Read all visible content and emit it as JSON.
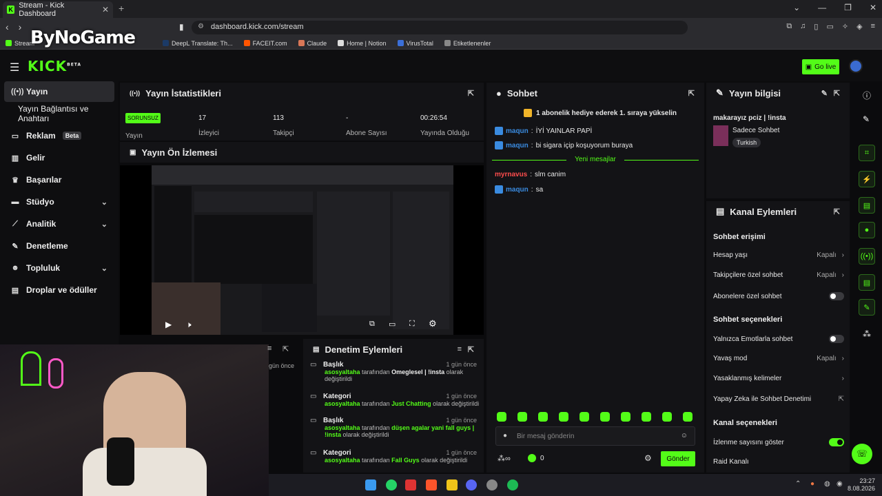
{
  "browser": {
    "tab_title": "Stream - Kick Dashboard",
    "url": "dashboard.kick.com/stream",
    "bookmarks": [
      "Stream",
      "DeepL Translate: Th...",
      "FACEIT.com",
      "Claude",
      "Home | Notion",
      "VirusTotal",
      "Etiketlenenler"
    ]
  },
  "overlay_logo": "ByNoGame",
  "header": {
    "logo": "KICK",
    "logo_badge": "BETA",
    "go_live": "Go live"
  },
  "sidebar": {
    "items": [
      {
        "label": "Yayın",
        "icon": "broadcast-icon"
      },
      {
        "label": "Yayın Bağlantısı ve Anahtarı",
        "icon": ""
      },
      {
        "label": "Reklam",
        "icon": "ad-icon",
        "badge": "Beta"
      },
      {
        "label": "Gelir",
        "icon": "revenue-icon"
      },
      {
        "label": "Başarılar",
        "icon": "trophy-icon"
      },
      {
        "label": "Stüdyo",
        "icon": "studio-icon"
      },
      {
        "label": "Analitik",
        "icon": "analytics-icon"
      },
      {
        "label": "Denetleme",
        "icon": "wrench-icon"
      },
      {
        "label": "Topluluk",
        "icon": "community-icon"
      },
      {
        "label": "Droplar ve ödüller",
        "icon": "drops-icon"
      }
    ]
  },
  "stats": {
    "title": "Yayın İstatistikleri",
    "items": [
      {
        "value": "SORUNSUZ",
        "label": "Yayın"
      },
      {
        "value": "17",
        "label": "İzleyici"
      },
      {
        "value": "113",
        "label": "Takipçi"
      },
      {
        "value": "-",
        "label": "Abone Sayısı"
      },
      {
        "value": "00:26:54",
        "label": "Yayında Olduğu"
      }
    ]
  },
  "preview": {
    "title": "Yayın Ön İzlemesi"
  },
  "chat": {
    "title": "Sohbet",
    "pinned": "1 abonelik hediye ederek 1. sıraya yükselin",
    "messages_before": [
      {
        "user": "maqun",
        "text": "İYİ YAINLAR PAPİ",
        "color": "#3a8be0"
      },
      {
        "user": "maqun",
        "text": "bi sigara içip koşuyorum buraya",
        "color": "#3a8be0"
      }
    ],
    "new_messages_label": "Yeni mesajlar",
    "messages_after": [
      {
        "user": "myrnavus",
        "text": "slm canim",
        "color": "#ff4d4d"
      },
      {
        "user": "maqun",
        "text": "sa",
        "color": "#3a8be0"
      }
    ],
    "input_placeholder": "Bir mesaj gönderin",
    "points": "0",
    "send": "Gönder"
  },
  "stream_info": {
    "title": "Yayın bilgisi",
    "stream_title": "makarayız pciz | !insta",
    "category": "Sadece Sohbet",
    "tag": "Turkish"
  },
  "channel_actions": {
    "title": "Kanal Eylemleri",
    "chat_access": "Sohbet erişimi",
    "account_age": {
      "label": "Hesap yaşı",
      "value": "Kapalı"
    },
    "followers_only": {
      "label": "Takipçilere özel sohbet",
      "value": "Kapalı"
    },
    "subscribers_only": {
      "label": "Abonelere özel sohbet"
    },
    "chat_options": "Sohbet seçenekleri",
    "emotes_only": {
      "label": "Yalnızca Emotlarla sohbet"
    },
    "slow_mode": {
      "label": "Yavaş mod",
      "value": "Kapalı"
    },
    "banned_words": {
      "label": "Yasaklanmış kelimeler"
    },
    "ai_moderation": {
      "label": "Yapay Zeka ile Sohbet Denetimi"
    },
    "channel_options": "Kanal seçenekleri",
    "show_viewers": {
      "label": "İzlenme sayısını göster"
    },
    "raid": {
      "label": "Raid Kanalı"
    }
  },
  "moderation": {
    "title": "Denetim Eylemleri",
    "left_when": "gün önce",
    "entries": [
      {
        "type": "Başlık",
        "when": "1 gün önce",
        "user": "asosyaltaha",
        "mid": "tarafından",
        "value": "Omeglesel | !insta",
        "tail": "olarak değiştirildi"
      },
      {
        "type": "Kategori",
        "when": "1 gün önce",
        "user": "asosyaltaha",
        "mid": "tarafından",
        "value": "Just Chatting",
        "tail": "olarak değiştirildi"
      },
      {
        "type": "Başlık",
        "when": "1 gün önce",
        "user": "asosyaltaha",
        "mid": "tarafından",
        "value": "düşen agalar yani fall guys | !insta",
        "tail": "olarak değiştirildi"
      },
      {
        "type": "Kategori",
        "when": "1 gün önce",
        "user": "asosyaltaha",
        "mid": "tarafından",
        "value": "Fall Guys",
        "tail": "olarak değiştirildi"
      }
    ]
  },
  "taskbar": {
    "time": "23:27",
    "date": "8.08.2026"
  },
  "colors": {
    "accent": "#53fc18",
    "bg": "#0b0b0d",
    "panel": "#131316"
  }
}
